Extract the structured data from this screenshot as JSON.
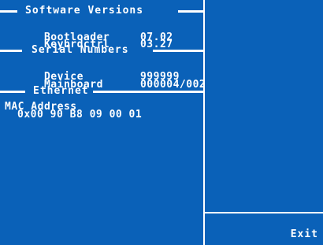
{
  "sections": {
    "software": {
      "title": "Software Versions",
      "rows": [
        {
          "label": "Bootloader",
          "value": "07.02"
        },
        {
          "label": "Keybrdctrl",
          "value": "03.27"
        }
      ]
    },
    "serial": {
      "title": "Serial Numbers",
      "rows": [
        {
          "label": "Device",
          "value": "999999"
        },
        {
          "label": "Mainboard",
          "value": "000004/002"
        }
      ]
    },
    "ethernet": {
      "title": "Ethernet",
      "mac_label": "MAC Address",
      "mac_value": "0x00 90 B8 09 00 01"
    }
  },
  "actions": {
    "exit_label": "Exit"
  },
  "colors": {
    "background": "#0a61b8",
    "foreground": "#ffffff"
  }
}
